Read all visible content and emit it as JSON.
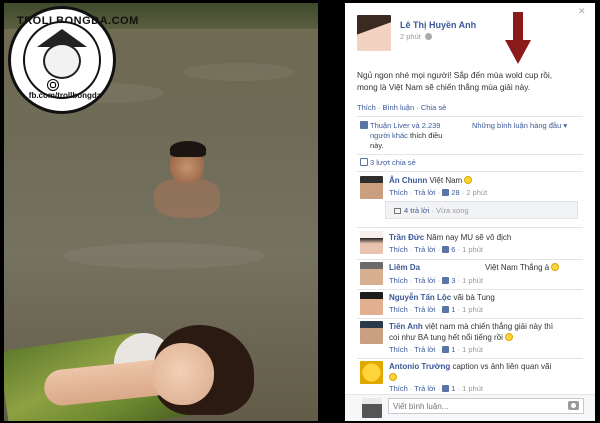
{
  "logo": {
    "text_top": "TROLLBONGDA.COM",
    "text_bottom": "fb.com/trollbongda"
  },
  "post": {
    "author": "Lê Thị Huyền Anh",
    "time": "2 phút",
    "text_line1": "Ngủ ngon nhé mọi người! Sắp đến mùa wold cup rồi,",
    "text_line2": "mong là Việt Nam sẽ chiến thắng mùa giải này.",
    "actions": {
      "like": "Thích",
      "comment": "Bình luận",
      "share": "Chia sẻ"
    },
    "likes_line1": "Thuận Liver và 2.239",
    "likes_line2_a": "người khác",
    "likes_line2_b": " thích điều",
    "likes_line3": "này.",
    "sort_label": "Những bình luận hàng đầu ▾",
    "shares": "3 lượt chia sẻ"
  },
  "comments": [
    {
      "author": "Ân Chunn",
      "text": "Việt Nam ",
      "meta_like": "Thích",
      "meta_reply": "Trả lời",
      "likes": "28",
      "time": "2 phút",
      "replies_label": "4 trả lời",
      "replies_time": "Vừa xong"
    },
    {
      "author": "Trần Đức",
      "text": "Năm nay MU sẽ vô địch",
      "meta_like": "Thích",
      "meta_reply": "Trả lời",
      "likes": "6",
      "time": "1 phút"
    },
    {
      "author": "Liêm Da",
      "text": "Việt Nam Thắng à ",
      "meta_like": "Thích",
      "meta_reply": "Trả lời",
      "likes": "3",
      "time": "1 phút"
    },
    {
      "author": "Nguyễn Tấn Lộc",
      "text": "vãi bà Tung",
      "meta_like": "Thích",
      "meta_reply": "Trả lời",
      "likes": "1",
      "time": "1 phút"
    },
    {
      "author": "Tiến Anh",
      "text": "việt nam mà chiến thắng giải này thì",
      "text2": "coi như BA tung hết nổi tiếng rồi ",
      "meta_like": "Thích",
      "meta_reply": "Trả lời",
      "likes": "1",
      "time": "1 phút"
    },
    {
      "author": "Antonio Trường",
      "text": "caption vs ảnh liên quan vãi",
      "meta_like": "Thích",
      "meta_reply": "Trả lời",
      "likes": "1",
      "time": "1 phút"
    }
  ],
  "composer": {
    "placeholder": "Viết bình luận..."
  },
  "colors": {
    "link": "#3b5998",
    "arrow": "#8b1a1a"
  }
}
